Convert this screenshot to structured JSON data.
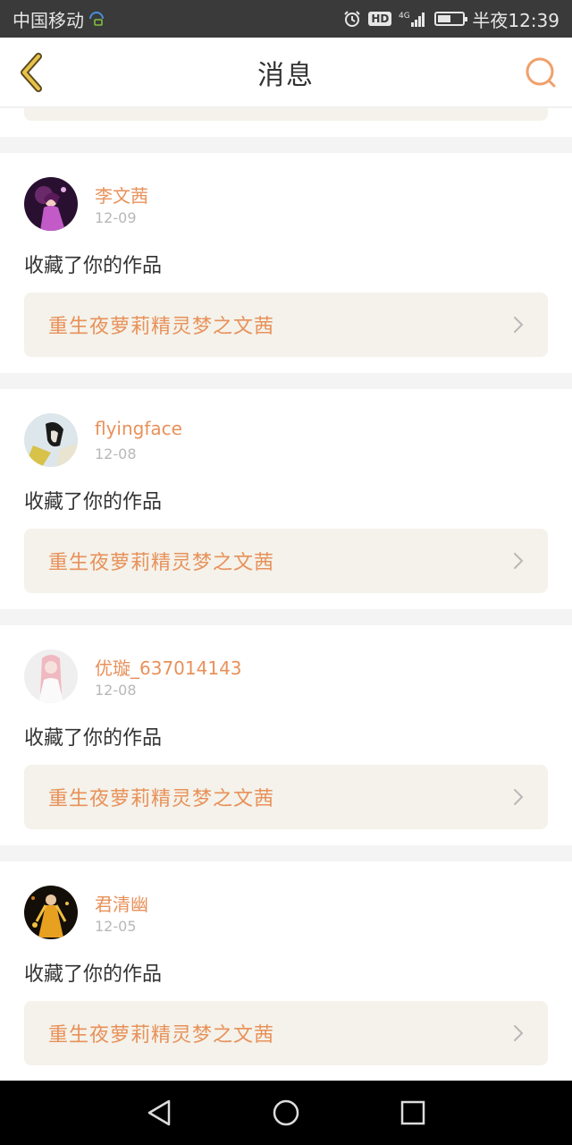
{
  "status_bar": {
    "carrier": "中国移动",
    "network": "4G",
    "hd": "HD",
    "time": "半夜12:39",
    "battery_level": 0.6
  },
  "header": {
    "title": "消息",
    "back_icon": "back-chevron-icon",
    "search_icon": "search-icon",
    "accent_color": "#e8915a"
  },
  "messages": [
    {
      "username": "李文茜",
      "date": "12-09",
      "action": "收藏了你的作品",
      "work_title": "重生夜萝莉精灵梦之文茜"
    },
    {
      "username": "flyingface",
      "date": "12-08",
      "action": "收藏了你的作品",
      "work_title": "重生夜萝莉精灵梦之文茜"
    },
    {
      "username": "优璇_637014143",
      "date": "12-08",
      "action": "收藏了你的作品",
      "work_title": "重生夜萝莉精灵梦之文茜"
    },
    {
      "username": "君清幽",
      "date": "12-05",
      "action": "收藏了你的作品",
      "work_title": "重生夜萝莉精灵梦之文茜"
    }
  ],
  "nav_bar": {
    "back": "nav-back-icon",
    "home": "nav-home-icon",
    "recents": "nav-recents-icon"
  }
}
